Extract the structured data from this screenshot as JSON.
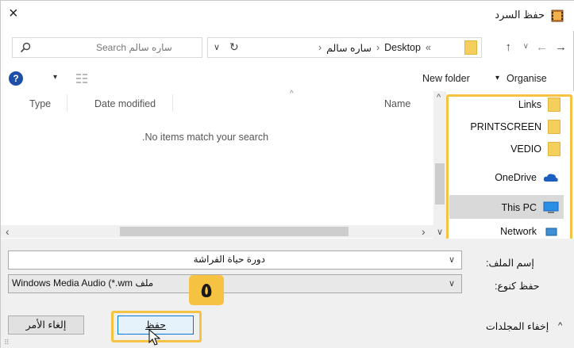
{
  "window": {
    "title": "حفظ السرد",
    "close_symbol": "×"
  },
  "toolbar": {
    "breadcrumb": [
      "«",
      "Desktop",
      "›",
      "ساره سالم",
      "›"
    ],
    "refresh_symbol": "↻",
    "dropdown_symbol": "∨",
    "search_placeholder": "Search ساره سالم"
  },
  "cmdbar": {
    "new_folder": "New folder",
    "organise": "Organise",
    "organise_arrow": "▾",
    "view_arrow": "▾",
    "help": "?"
  },
  "list": {
    "columns": [
      "Name",
      "Date modified",
      "Type"
    ],
    "empty_message": ".No items match your search"
  },
  "scroll": {
    "left_arrow": "‹",
    "right_arrow": "›",
    "up_arrow": "^",
    "down_arrow": "∨",
    "sort_arrow": "^"
  },
  "navpane": {
    "items": [
      {
        "label": "Links",
        "icon": "folder-icon"
      },
      {
        "label": "PRINTSCREEN",
        "icon": "folder-icon"
      },
      {
        "label": "VEDIO",
        "icon": "folder-icon"
      },
      {
        "label": "OneDrive",
        "icon": "cloud-icon"
      },
      {
        "label": "This PC",
        "icon": "computer-icon"
      },
      {
        "label": "Network",
        "icon": "network-icon"
      }
    ]
  },
  "form": {
    "filename_label": "إسم الملف:",
    "filename_value": "دورة حياة الفراشة",
    "type_label": "حفظ كنوع:",
    "type_value": "ملف Windows Media Audio (*.wm",
    "hide_folders": "إخفاء المجلدات",
    "hide_arrow": "^",
    "save": "حفظ",
    "cancel": "إلغاء الأمر",
    "combo_arrow": "∨"
  },
  "annotation": {
    "step_number": "٥"
  },
  "colors": {
    "highlight": "#f6c242",
    "folder": "#f5cf5d",
    "accent": "#0078d7"
  }
}
